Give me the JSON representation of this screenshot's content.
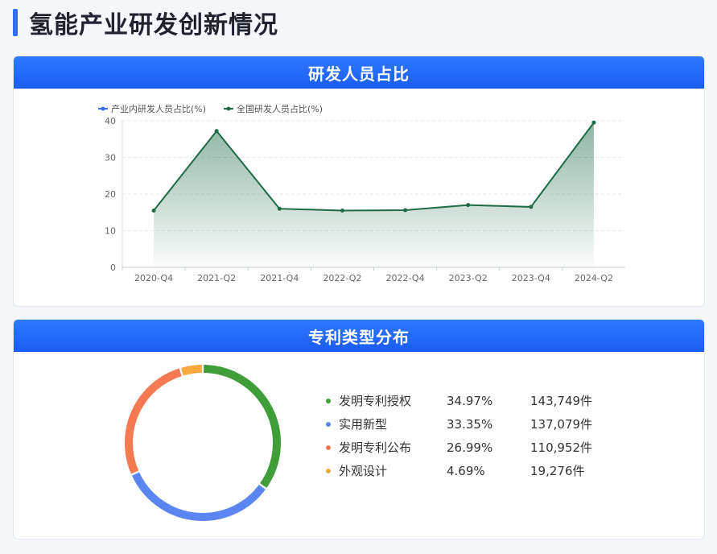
{
  "page": {
    "title": "氢能产业研发创新情况"
  },
  "cards": {
    "rd": {
      "title": "研发人员占比"
    },
    "patent": {
      "title": "专利类型分布"
    }
  },
  "colors": {
    "accent": "#2f6bff",
    "header_start": "#2f79ff",
    "header_end": "#1a5cf2",
    "series_industry": "#3b6ff5",
    "series_national": "#1e6b46"
  },
  "chart_data": [
    {
      "type": "area",
      "title": "研发人员占比",
      "categories": [
        "2020-Q4",
        "2021-Q2",
        "2021-Q4",
        "2022-Q2",
        "2022-Q4",
        "2023-Q2",
        "2023-Q4",
        "2024-Q2"
      ],
      "series": [
        {
          "name": "产业内研发人员占比(%)",
          "values": [],
          "color": "#3b6ff5"
        },
        {
          "name": "全国研发人员占比(%)",
          "values": [
            15.5,
            37.2,
            16.0,
            15.5,
            15.6,
            17.0,
            16.5,
            39.5
          ],
          "color": "#1e6b46"
        }
      ],
      "ylim": [
        0,
        40
      ],
      "yticks": [
        0,
        10,
        20,
        30,
        40
      ],
      "grid": true,
      "legend": "top-left"
    },
    {
      "type": "pie",
      "title": "专利类型分布",
      "slices": [
        {
          "name": "发明专利授权",
          "pct": "34.97%",
          "count": "143,749件",
          "value": 34.97,
          "color": "#3f9e3a"
        },
        {
          "name": "实用新型",
          "pct": "33.35%",
          "count": "137,079件",
          "value": 33.35,
          "color": "#5b86f2"
        },
        {
          "name": "发明专利公布",
          "pct": "26.99%",
          "count": "110,952件",
          "value": 26.99,
          "color": "#f57a52"
        },
        {
          "name": "外观设计",
          "pct": "4.69%",
          "count": "19,276件",
          "value": 4.69,
          "color": "#f6a93d"
        }
      ],
      "legend": "right"
    }
  ]
}
